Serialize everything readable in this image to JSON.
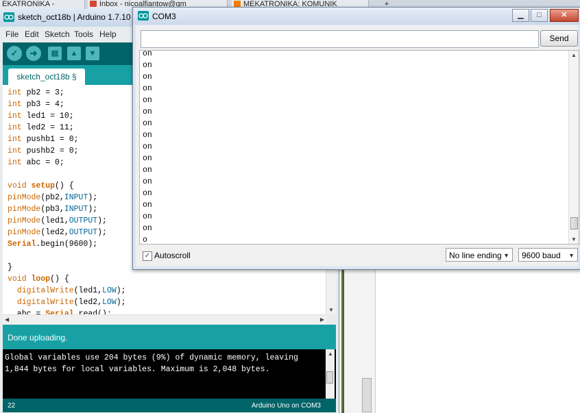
{
  "browser_tabs": [
    {
      "label": "EKATRONIKA -"
    },
    {
      "label": "Inbox - nicoalfiantow@gm"
    },
    {
      "label": "MEKATRONIKA: KOMUNIK"
    },
    {
      "label": "+"
    }
  ],
  "ide": {
    "title": "sketch_oct18b | Arduino 1.7.10",
    "menu": [
      "File",
      "Edit",
      "Sketch",
      "Tools",
      "Help"
    ],
    "tab_label": "sketch_oct18b §",
    "status_message": "Done uploading.",
    "console_lines": [
      "Global variables use 204 bytes (9%) of dynamic memory, leaving",
      "1,844 bytes for local variables. Maximum is 2,048 bytes."
    ],
    "footer_line": "22",
    "footer_board": "Arduino Uno on COM3"
  },
  "serial_monitor": {
    "title": "COM3",
    "input_value": "",
    "send_label": "Send",
    "output_lines": [
      "on",
      "on",
      "on",
      "on",
      "on",
      "on",
      "on",
      "on",
      "on",
      "on",
      "on",
      "on",
      "on",
      "on",
      "on",
      "on",
      "o"
    ],
    "autoscroll_label": "Autoscroll",
    "autoscroll_checked": true,
    "line_ending": "No line ending",
    "baud": "9600 baud"
  },
  "colors": {
    "arduino_dark": "#006468",
    "arduino_teal": "#17a1a5",
    "keyword_orange": "#cc6600",
    "constant_blue": "#006699"
  }
}
